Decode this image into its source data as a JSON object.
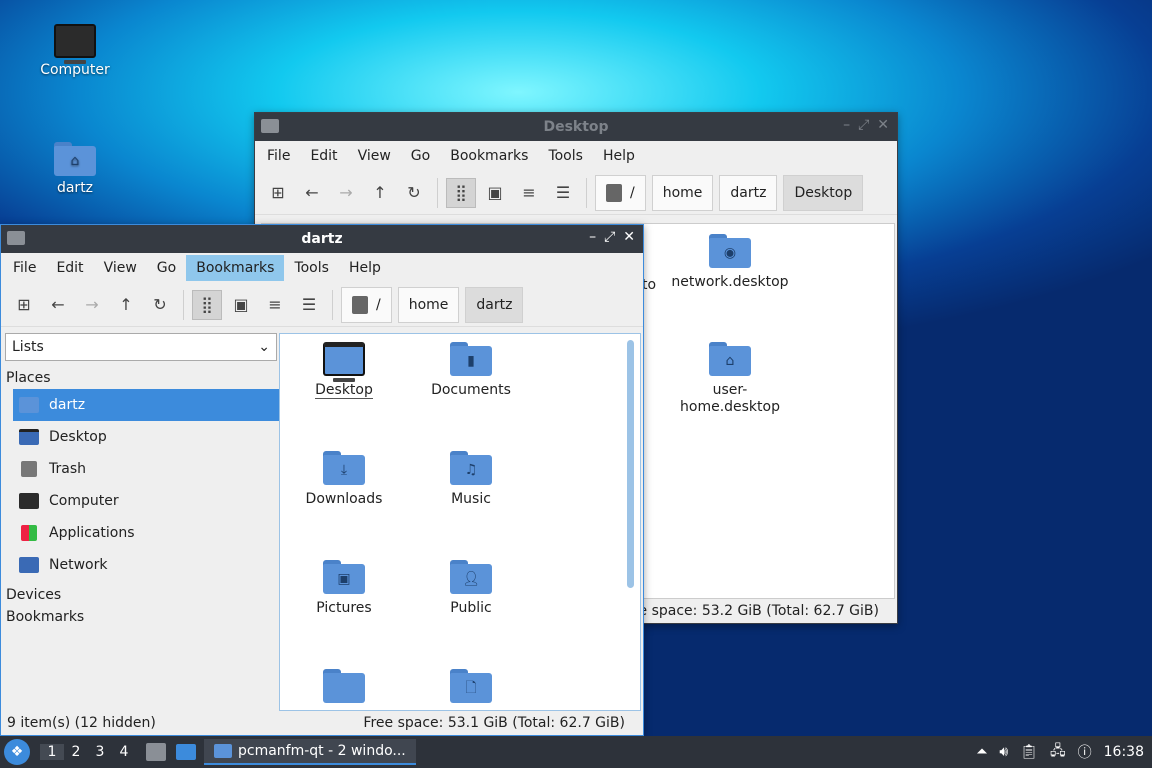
{
  "desktop": {
    "icons": [
      {
        "label": "Computer",
        "icon": "computer-icon"
      },
      {
        "label": "dartz",
        "icon": "home-folder-icon"
      }
    ]
  },
  "window_back": {
    "title": "Desktop",
    "menu": [
      "File",
      "Edit",
      "View",
      "Go",
      "Bookmarks",
      "Tools",
      "Help"
    ],
    "path": [
      "/",
      "home",
      "dartz",
      "Desktop"
    ],
    "items": [
      {
        "label": "network.desktop",
        "icon": "network-folder-icon"
      },
      {
        "label_line1": "user-",
        "label_line2": "home.desktop",
        "icon": "home-folder-icon"
      }
    ],
    "partial_label": "to",
    "status_right": "ee space: 53.2 GiB (Total: 62.7 GiB)"
  },
  "window_front": {
    "title": "dartz",
    "menu": [
      "File",
      "Edit",
      "View",
      "Go",
      "Bookmarks",
      "Tools",
      "Help"
    ],
    "active_menu": "Bookmarks",
    "path": [
      "/",
      "home",
      "dartz"
    ],
    "sidebar": {
      "selector": "Lists",
      "places_header": "Places",
      "places": [
        "dartz",
        "Desktop",
        "Trash",
        "Computer",
        "Applications",
        "Network"
      ],
      "devices_header": "Devices",
      "bookmarks_header": "Bookmarks"
    },
    "items": [
      "Desktop",
      "Documents",
      "Downloads",
      "Music",
      "Pictures",
      "Public"
    ],
    "status_left": "9 item(s) (12 hidden)",
    "status_right": "Free space: 53.1 GiB (Total: 62.7 GiB)"
  },
  "taskbar": {
    "desktops": [
      "1",
      "2",
      "3",
      "4"
    ],
    "task_label": "pcmanfm-qt - 2 windo...",
    "clock": "16:38"
  },
  "colors": {
    "accent": "#3c8bdc",
    "folder": "#5b93d9",
    "titlebar": "#353a42"
  }
}
